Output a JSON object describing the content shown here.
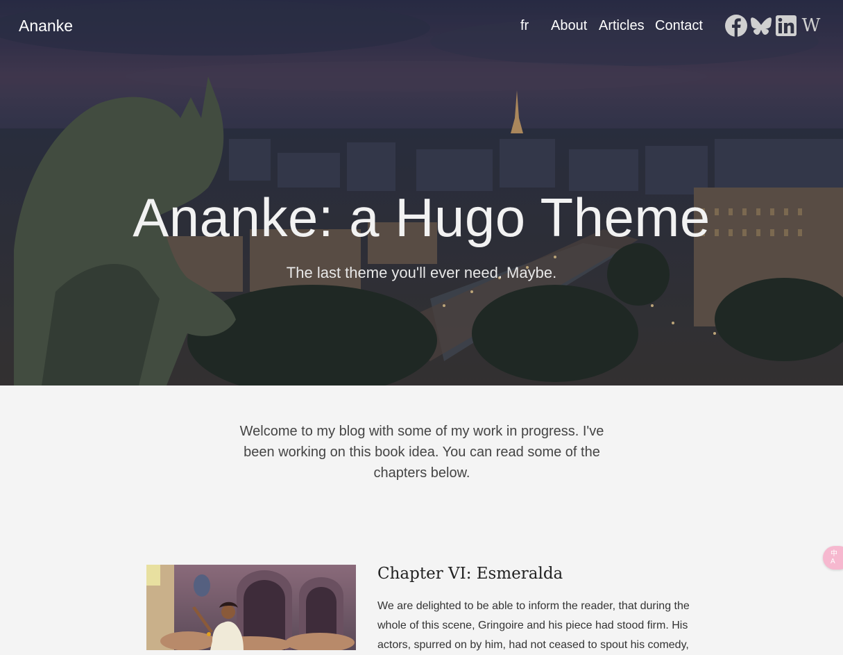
{
  "header": {
    "site_title": "Ananke",
    "nav": {
      "lang": "fr",
      "about": "About",
      "articles": "Articles",
      "contact": "Contact"
    },
    "social": [
      "facebook-icon",
      "bluesky-icon",
      "linkedin-icon",
      "wikipedia-icon"
    ]
  },
  "hero": {
    "title": "Ananke: a Hugo Theme",
    "tagline": "The last theme you'll ever need. Maybe."
  },
  "intro": "Welcome to my blog with some of my work in progress. I've been working on this book idea. You can read some of the chapters below.",
  "articles": [
    {
      "title": "Chapter VI: Esmeralda",
      "excerpt": "We are delighted to be able to inform the reader, that during the whole of this scene, Gringoire and his piece had stood firm. His actors, spurred on by him, had not ceased to spout his comedy,"
    }
  ],
  "translate_badge": {
    "line1": "中",
    "line2": "A"
  },
  "colors": {
    "hero_overlay": "#1f2333",
    "page_background": "#f4f4f4",
    "badge": "#f6b8cf"
  }
}
